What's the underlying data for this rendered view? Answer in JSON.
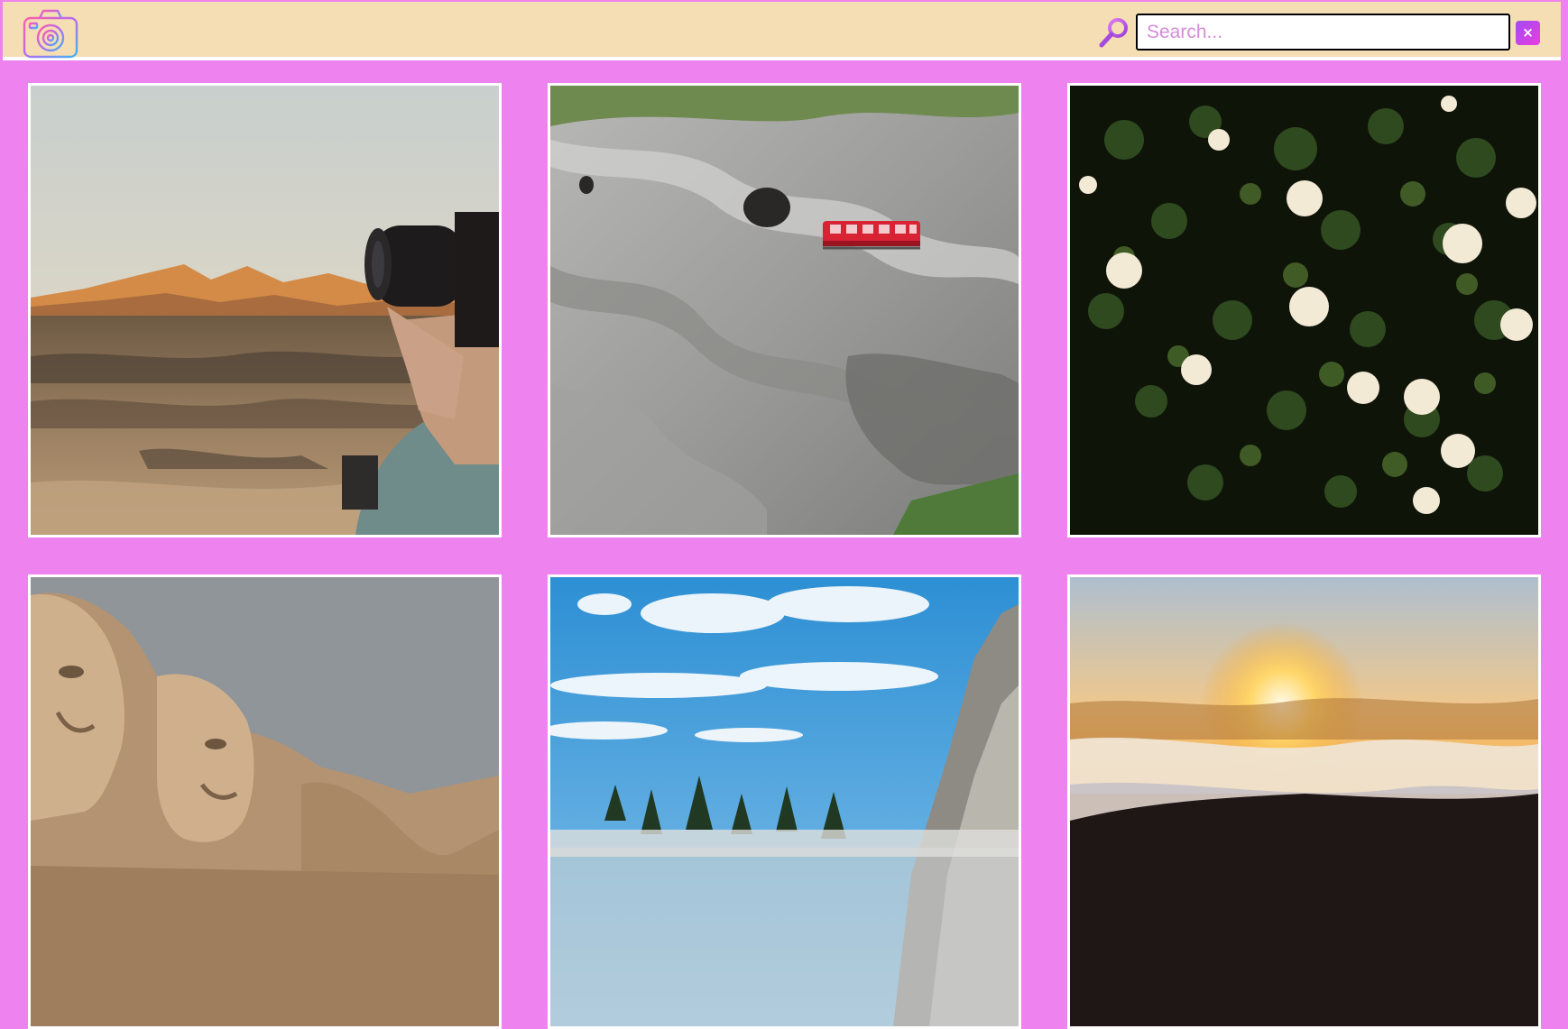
{
  "header": {
    "logo_icon": "camera-icon",
    "search_icon": "magnifier-icon",
    "search_placeholder": "Search...",
    "search_value": "",
    "clear_label": "×",
    "colors": {
      "page_background": "#ee82ee",
      "header_background": "#f5deb3",
      "clear_button_gradient": [
        "#a14cf2",
        "#e93ee0"
      ]
    }
  },
  "gallery": {
    "photos": [
      {
        "subject": "photographer-desert-sunset"
      },
      {
        "subject": "red-train-on-cliff"
      },
      {
        "subject": "white-flowers-dark-foliage"
      },
      {
        "subject": "mount-rushmore"
      },
      {
        "subject": "blue-sky-rocky-peak"
      },
      {
        "subject": "sunset-over-clouds"
      }
    ]
  }
}
